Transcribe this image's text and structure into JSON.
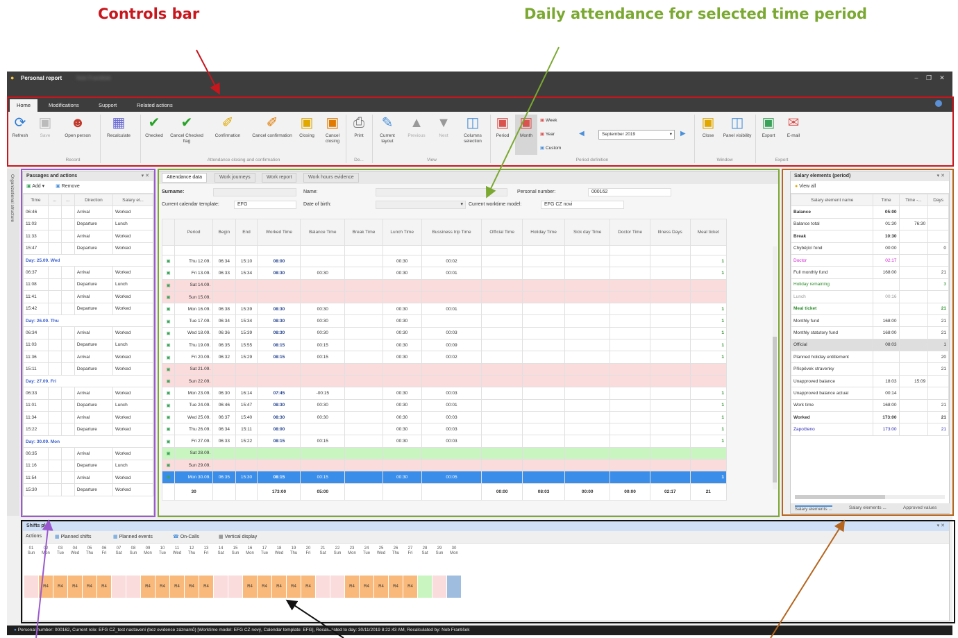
{
  "annotations": {
    "controls_bar": "Controls bar",
    "daily_attendance": "Daily attendance for selected time period",
    "colors": {
      "controls": "#c8161d",
      "attendance": "#7aa830",
      "passages": "#9b59d0",
      "salary": "#b5651d",
      "shifts": "#111111"
    }
  },
  "window": {
    "title": "Personal report",
    "user_blurred": "Nob František"
  },
  "ribbon": {
    "tabs": [
      "Home",
      "Modifications",
      "Support",
      "Related actions"
    ],
    "buttons": {
      "refresh": "Refresh",
      "save": "Save",
      "open_person": "Open person",
      "recalculate": "Recalculate",
      "checked": "Checked",
      "cancel_checked_flag": "Cancel Checked flag",
      "confirmation": "Confirmation",
      "cancel_confirmation": "Cancel confirmation",
      "closing": "Closing",
      "cancel_closing": "Cancel closing",
      "print": "Print",
      "current_layout": "Current layout",
      "previous": "Previous",
      "next": "Next",
      "columns_selection": "Columns selection",
      "period": "Period",
      "month": "Month",
      "week": "Week",
      "year": "Year",
      "custom": "Custom",
      "close": "Close",
      "panel_visibility": "Panel visibility",
      "export": "Export",
      "email": "E-mail"
    },
    "period_value": "September 2019",
    "groups": {
      "record": "Record",
      "closing": "Attendance closing and confirmation",
      "de": "De...",
      "view": "View",
      "period": "Period definition",
      "window": "Window",
      "export": "Export"
    }
  },
  "side_tab": "Organizational structure",
  "passages": {
    "title": "Passages and actions",
    "add": "Add",
    "remove": "Remove",
    "columns": [
      "Time",
      "...",
      "...",
      "Direction",
      "Salary el..."
    ],
    "groups": [
      {
        "label": "",
        "rows": [
          [
            "06:46",
            "Arrival",
            "Worked"
          ],
          [
            "11:03",
            "Departure",
            "Lunch"
          ],
          [
            "11:33",
            "Arrival",
            "Worked"
          ],
          [
            "15:47",
            "Departure",
            "Worked"
          ]
        ]
      },
      {
        "label": "Day: 25.09. Wed",
        "rows": [
          [
            "06:37",
            "Arrival",
            "Worked"
          ],
          [
            "11:08",
            "Departure",
            "Lunch"
          ],
          [
            "11:41",
            "Arrival",
            "Worked"
          ],
          [
            "15:42",
            "Departure",
            "Worked"
          ]
        ]
      },
      {
        "label": "Day: 26.09. Thu",
        "rows": [
          [
            "06:34",
            "Arrival",
            "Worked"
          ],
          [
            "11:03",
            "Departure",
            "Lunch"
          ],
          [
            "11:36",
            "Arrival",
            "Worked"
          ],
          [
            "15:11",
            "Departure",
            "Worked"
          ]
        ]
      },
      {
        "label": "Day: 27.09. Fri",
        "rows": [
          [
            "06:33",
            "Arrival",
            "Worked"
          ],
          [
            "11:01",
            "Departure",
            "Lunch"
          ],
          [
            "11:34",
            "Arrival",
            "Worked"
          ],
          [
            "15:22",
            "Departure",
            "Worked"
          ]
        ]
      },
      {
        "label": "Day: 30.09. Mon",
        "rows": [
          [
            "06:35",
            "Arrival",
            "Worked"
          ],
          [
            "11:16",
            "Departure",
            "Lunch"
          ],
          [
            "11:54",
            "Arrival",
            "Worked"
          ],
          [
            "15:30",
            "Departure",
            "Worked"
          ]
        ]
      }
    ]
  },
  "attendance": {
    "tabs": [
      "Attendance data",
      "Work journeys",
      "Work report",
      "Work hours evidence"
    ],
    "fields": {
      "surname_label": "Surname:",
      "name_label": "Name:",
      "personal_number_label": "Personal number:",
      "personal_number": "000162",
      "calendar_label": "Current calendar template:",
      "calendar": "EFG",
      "dob_label": "Date of birth:",
      "worktime_label": "Current worktime model:",
      "worktime": "EFG CZ novi"
    },
    "columns": [
      "Period",
      "Begin",
      "End",
      "Worked Time",
      "Balance Time",
      "Break Time",
      "Lunch Time",
      "Bussiness trip Time",
      "Official Time",
      "Holiday Time",
      "Sick day Time",
      "Doctor Time",
      "Illness Days",
      "Meal ticket"
    ],
    "rows": [
      {
        "period": "Thu 12.09.",
        "begin": "06:34",
        "end": "15:10",
        "worked": "08:00",
        "balance": "",
        "brk": "",
        "lunch": "00:30",
        "trip": "00:02",
        "meal": "1",
        "style": ""
      },
      {
        "period": "Fri 13.09.",
        "begin": "06:33",
        "end": "15:34",
        "worked": "08:30",
        "balance": "00:30",
        "brk": "",
        "lunch": "00:30",
        "trip": "00:01",
        "meal": "1",
        "style": ""
      },
      {
        "period": "Sat 14.09.",
        "begin": "",
        "end": "",
        "worked": "",
        "balance": "",
        "brk": "",
        "lunch": "",
        "trip": "",
        "meal": "",
        "style": "pink"
      },
      {
        "period": "Sun 15.09.",
        "begin": "",
        "end": "",
        "worked": "",
        "balance": "",
        "brk": "",
        "lunch": "",
        "trip": "",
        "meal": "",
        "style": "pink"
      },
      {
        "period": "Mon 16.09.",
        "begin": "06:38",
        "end": "15:39",
        "worked": "08:30",
        "balance": "00:30",
        "brk": "",
        "lunch": "00:30",
        "trip": "00:01",
        "meal": "1",
        "style": ""
      },
      {
        "period": "Tue 17.09.",
        "begin": "06:34",
        "end": "15:34",
        "worked": "08:30",
        "balance": "00:30",
        "brk": "",
        "lunch": "00:30",
        "trip": "",
        "meal": "1",
        "style": ""
      },
      {
        "period": "Wed 18.09.",
        "begin": "06:36",
        "end": "15:39",
        "worked": "08:30",
        "balance": "00:30",
        "brk": "",
        "lunch": "00:30",
        "trip": "00:03",
        "meal": "1",
        "style": ""
      },
      {
        "period": "Thu 19.09.",
        "begin": "06:35",
        "end": "15:55",
        "worked": "08:15",
        "balance": "00:15",
        "brk": "",
        "lunch": "00:30",
        "trip": "00:09",
        "meal": "1",
        "style": ""
      },
      {
        "period": "Fri 20.09.",
        "begin": "06:32",
        "end": "15:29",
        "worked": "08:15",
        "balance": "00:15",
        "brk": "",
        "lunch": "00:30",
        "trip": "00:02",
        "meal": "1",
        "style": ""
      },
      {
        "period": "Sat 21.09.",
        "begin": "",
        "end": "",
        "worked": "",
        "balance": "",
        "brk": "",
        "lunch": "",
        "trip": "",
        "meal": "",
        "style": "pink"
      },
      {
        "period": "Sun 22.09.",
        "begin": "",
        "end": "",
        "worked": "",
        "balance": "",
        "brk": "",
        "lunch": "",
        "trip": "",
        "meal": "",
        "style": "pink"
      },
      {
        "period": "Mon 23.09.",
        "begin": "06:30",
        "end": "16:14",
        "worked": "07:45",
        "balance": "-00:15",
        "brk": "",
        "lunch": "00:30",
        "trip": "00:03",
        "meal": "1",
        "style": ""
      },
      {
        "period": "Tue 24.09.",
        "begin": "06:46",
        "end": "15:47",
        "worked": "08:30",
        "balance": "00:30",
        "brk": "",
        "lunch": "00:30",
        "trip": "00:01",
        "meal": "1",
        "style": ""
      },
      {
        "period": "Wed 25.09.",
        "begin": "06:37",
        "end": "15:40",
        "worked": "08:30",
        "balance": "00:30",
        "brk": "",
        "lunch": "00:30",
        "trip": "00:03",
        "meal": "1",
        "style": ""
      },
      {
        "period": "Thu 26.09.",
        "begin": "06:34",
        "end": "15:11",
        "worked": "08:00",
        "balance": "",
        "brk": "",
        "lunch": "00:30",
        "trip": "00:03",
        "meal": "1",
        "style": ""
      },
      {
        "period": "Fri 27.09.",
        "begin": "06:33",
        "end": "15:22",
        "worked": "08:15",
        "balance": "00:15",
        "brk": "",
        "lunch": "00:30",
        "trip": "00:03",
        "meal": "1",
        "style": ""
      },
      {
        "period": "Sat 28.09.",
        "begin": "",
        "end": "",
        "worked": "",
        "balance": "",
        "brk": "",
        "lunch": "",
        "trip": "",
        "meal": "",
        "style": "green"
      },
      {
        "period": "Sun 29.09.",
        "begin": "",
        "end": "",
        "worked": "",
        "balance": "",
        "brk": "",
        "lunch": "",
        "trip": "",
        "meal": "",
        "style": "pink"
      },
      {
        "period": "Mon 30.09.",
        "begin": "06:35",
        "end": "15:30",
        "worked": "08:15",
        "balance": "00:15",
        "brk": "",
        "lunch": "00:30",
        "trip": "00:05",
        "meal": "1",
        "style": "sel"
      }
    ],
    "totals": {
      "count": "30",
      "worked": "173:00",
      "balance": "05:00",
      "official": "00:00",
      "holiday": "08:03",
      "sick": "00:00",
      "doctor": "00:00",
      "illness": "02:17",
      "meal": "21"
    }
  },
  "salary": {
    "title": "Salary elements (period)",
    "view_all": "View all",
    "columns": [
      "Salary element name",
      "Time",
      "Time -...",
      "Days"
    ],
    "rows": [
      {
        "name": "Balance",
        "time": "05:00",
        "time2": "",
        "days": "",
        "style": "bold"
      },
      {
        "name": "Balance total",
        "time": "01:30",
        "time2": "76:30",
        "days": "",
        "style": ""
      },
      {
        "name": "Break",
        "time": "10:30",
        "time2": "",
        "days": "",
        "style": "bold"
      },
      {
        "name": "Chybějící fond",
        "time": "00:00",
        "time2": "",
        "days": "0",
        "style": ""
      },
      {
        "name": "Doctor",
        "time": "02:17",
        "time2": "",
        "days": "",
        "style": "magenta"
      },
      {
        "name": "Full monthly fund",
        "time": "168:00",
        "time2": "",
        "days": "21",
        "style": ""
      },
      {
        "name": "Holiday remaining",
        "time": "",
        "time2": "",
        "days": "3",
        "style": "green"
      },
      {
        "name": "Lunch",
        "time": "00:16",
        "time2": "",
        "days": "",
        "style": "grey"
      },
      {
        "name": "Meal ticket",
        "time": "",
        "time2": "",
        "days": "21",
        "style": "boldgreen"
      },
      {
        "name": "Monthly fund",
        "time": "168:00",
        "time2": "",
        "days": "21",
        "style": ""
      },
      {
        "name": "Monthly statutory fund",
        "time": "168:00",
        "time2": "",
        "days": "21",
        "style": ""
      },
      {
        "name": "Official",
        "time": "08:03",
        "time2": "",
        "days": "1",
        "style": "shade"
      },
      {
        "name": "Planned holiday entitlement",
        "time": "",
        "time2": "",
        "days": "20",
        "style": ""
      },
      {
        "name": "Příspěvek stravenky",
        "time": "",
        "time2": "",
        "days": "21",
        "style": ""
      },
      {
        "name": "Unapproved balance",
        "time": "18:03",
        "time2": "15:09",
        "days": "",
        "style": ""
      },
      {
        "name": "Unapproved balance actual",
        "time": "00:14",
        "time2": "",
        "days": "",
        "style": ""
      },
      {
        "name": "Work time",
        "time": "168:00",
        "time2": "",
        "days": "21",
        "style": ""
      },
      {
        "name": "Worked",
        "time": "173:00",
        "time2": "",
        "days": "21",
        "style": "bold"
      },
      {
        "name": "Započteno",
        "time": "173:00",
        "time2": "",
        "days": "21",
        "style": "blue"
      }
    ],
    "bottom_tabs": [
      "Salary elements ...",
      "Salary elements ...",
      "Approved values"
    ]
  },
  "shifts": {
    "title": "Shifts plan",
    "toolbar": {
      "actions": "Actions",
      "planned_shifts": "Planned shifts",
      "planned_events": "Planned events",
      "on_calls": "On-Calls",
      "vertical_display": "Vertical display"
    },
    "days": [
      {
        "n": "01",
        "w": "Sun",
        "t": "pink",
        "l": ""
      },
      {
        "n": "02",
        "w": "Mon",
        "t": "orange",
        "l": "R4"
      },
      {
        "n": "03",
        "w": "Tue",
        "t": "orange",
        "l": "R4"
      },
      {
        "n": "04",
        "w": "Wed",
        "t": "orange",
        "l": "R4"
      },
      {
        "n": "05",
        "w": "Thu",
        "t": "orange",
        "l": "R4"
      },
      {
        "n": "06",
        "w": "Fri",
        "t": "orange",
        "l": "R4"
      },
      {
        "n": "07",
        "w": "Sat",
        "t": "pink",
        "l": ""
      },
      {
        "n": "08",
        "w": "Sun",
        "t": "pink",
        "l": ""
      },
      {
        "n": "09",
        "w": "Mon",
        "t": "orange",
        "l": "R4"
      },
      {
        "n": "10",
        "w": "Tue",
        "t": "orange",
        "l": "R4"
      },
      {
        "n": "11",
        "w": "Wed",
        "t": "orange",
        "l": "R4"
      },
      {
        "n": "12",
        "w": "Thu",
        "t": "orange",
        "l": "R4"
      },
      {
        "n": "13",
        "w": "Fri",
        "t": "orange",
        "l": "R4"
      },
      {
        "n": "14",
        "w": "Sat",
        "t": "pink",
        "l": ""
      },
      {
        "n": "15",
        "w": "Sun",
        "t": "pink",
        "l": ""
      },
      {
        "n": "16",
        "w": "Mon",
        "t": "orange",
        "l": "R4"
      },
      {
        "n": "17",
        "w": "Tue",
        "t": "orange",
        "l": "R4"
      },
      {
        "n": "18",
        "w": "Wed",
        "t": "orange",
        "l": "R4"
      },
      {
        "n": "19",
        "w": "Thu",
        "t": "orange",
        "l": "R4"
      },
      {
        "n": "20",
        "w": "Fri",
        "t": "orange",
        "l": "R4"
      },
      {
        "n": "21",
        "w": "Sat",
        "t": "pink",
        "l": ""
      },
      {
        "n": "22",
        "w": "Sun",
        "t": "pink",
        "l": ""
      },
      {
        "n": "23",
        "w": "Mon",
        "t": "orange",
        "l": "R4"
      },
      {
        "n": "24",
        "w": "Tue",
        "t": "orange",
        "l": "R4"
      },
      {
        "n": "25",
        "w": "Wed",
        "t": "orange",
        "l": "R4"
      },
      {
        "n": "26",
        "w": "Thu",
        "t": "orange",
        "l": "R4"
      },
      {
        "n": "27",
        "w": "Fri",
        "t": "orange",
        "l": "R4"
      },
      {
        "n": "28",
        "w": "Sat",
        "t": "green",
        "l": ""
      },
      {
        "n": "29",
        "w": "Sun",
        "t": "pink",
        "l": ""
      },
      {
        "n": "30",
        "w": "Mon",
        "t": "blue",
        "l": ""
      }
    ]
  },
  "status": {
    "text": "Personal number: 000162, Current role: EFG CZ_test nastavení (bez evidence záznamů) [Worktime model: EFG CZ nový, Calendar template: EFG], Recalculated to day: 30/11/2019 8:22:43 AM, Recalculated by: Nob František"
  }
}
